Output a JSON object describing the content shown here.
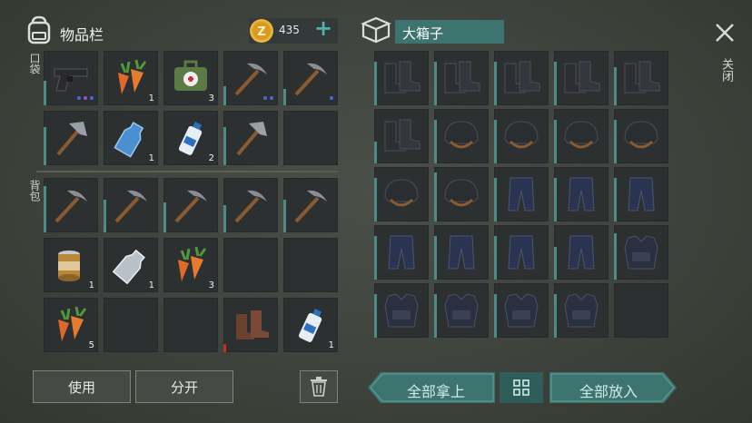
{
  "inventory": {
    "title": "物品栏",
    "coins": "435",
    "add_label": "+",
    "pocket_label": "口袋",
    "backpack_label": "背包",
    "use_button": "使用",
    "split_button": "分开",
    "slots": [
      {
        "icon": "pistol-icon",
        "qty": "",
        "dur": 0.45,
        "dots": [
          "#4a6bd0",
          "#8a5ad0",
          "#4a6bd0"
        ]
      },
      {
        "icon": "carrot-icon",
        "qty": "1",
        "dur": 0
      },
      {
        "icon": "medkit-icon",
        "qty": "3",
        "dur": 0
      },
      {
        "icon": "pickaxe-icon",
        "qty": "",
        "dur": 0.35,
        "dots": [
          "#4a6bd0",
          "#4a6bd0"
        ]
      },
      {
        "icon": "pickaxe-icon",
        "qty": "",
        "dur": 0.3,
        "dots": [
          "#4a6bd0"
        ]
      },
      {
        "icon": "hatchet-icon",
        "qty": "",
        "dur": 0.7
      },
      {
        "icon": "water-bottle-icon",
        "qty": "1",
        "dur": 0
      },
      {
        "icon": "spray-can-icon",
        "qty": "2",
        "dur": 0
      },
      {
        "icon": "hatchet-icon",
        "qty": "",
        "dur": 0.7
      },
      {
        "icon": "",
        "qty": "",
        "dur": 0
      },
      {
        "icon": "pickaxe-icon",
        "qty": "",
        "dur": 0.85
      },
      {
        "icon": "pickaxe-icon",
        "qty": "",
        "dur": 0.6
      },
      {
        "icon": "pickaxe-icon",
        "qty": "",
        "dur": 0.55
      },
      {
        "icon": "pickaxe-icon",
        "qty": "",
        "dur": 0.5
      },
      {
        "icon": "pickaxe-icon",
        "qty": "",
        "dur": 0.6
      },
      {
        "icon": "canned-food-icon",
        "qty": "1",
        "dur": 0
      },
      {
        "icon": "empty-bottle-icon",
        "qty": "1",
        "dur": 0
      },
      {
        "icon": "carrot-icon",
        "qty": "3",
        "dur": 0
      },
      {
        "icon": "",
        "qty": "",
        "dur": 0
      },
      {
        "icon": "",
        "qty": "",
        "dur": 0
      },
      {
        "icon": "carrot-icon",
        "qty": "5",
        "dur": 0
      },
      {
        "icon": "",
        "qty": "",
        "dur": 0
      },
      {
        "icon": "",
        "qty": "",
        "dur": 0
      },
      {
        "icon": "boots-brown-icon",
        "qty": "",
        "dur": 0.15,
        "durColor": "#c0302a"
      },
      {
        "icon": "spray-can-icon",
        "qty": "1",
        "dur": 0
      }
    ]
  },
  "box": {
    "title": "大箱子",
    "close_label": "关闭",
    "take_all_button": "全部拿上",
    "put_all_button": "全部放入",
    "slots": [
      {
        "icon": "boots-icon",
        "dur": 0.8
      },
      {
        "icon": "boots-icon",
        "dur": 0.8
      },
      {
        "icon": "boots-icon",
        "dur": 0.8
      },
      {
        "icon": "boots-icon",
        "dur": 0.8
      },
      {
        "icon": "boots-icon",
        "dur": 0.7
      },
      {
        "icon": "boots-icon",
        "dur": 0.4
      },
      {
        "icon": "helmet-icon",
        "dur": 0.8
      },
      {
        "icon": "helmet-icon",
        "dur": 0.8
      },
      {
        "icon": "helmet-icon",
        "dur": 0.8
      },
      {
        "icon": "helmet-icon",
        "dur": 0.8
      },
      {
        "icon": "helmet-icon",
        "dur": 0.8
      },
      {
        "icon": "helmet-icon",
        "dur": 0.9
      },
      {
        "icon": "pants-icon",
        "dur": 0.8
      },
      {
        "icon": "pants-icon",
        "dur": 0.8
      },
      {
        "icon": "pants-icon",
        "dur": 0.8
      },
      {
        "icon": "pants-icon",
        "dur": 0.8
      },
      {
        "icon": "pants-icon",
        "dur": 0.8
      },
      {
        "icon": "pants-icon",
        "dur": 0.8
      },
      {
        "icon": "pants-icon",
        "dur": 0.6
      },
      {
        "icon": "armor-vest-icon",
        "dur": 0.85
      },
      {
        "icon": "armor-vest-icon",
        "dur": 0.8
      },
      {
        "icon": "armor-vest-icon",
        "dur": 0.8
      },
      {
        "icon": "armor-vest-icon",
        "dur": 0.8
      },
      {
        "icon": "armor-vest-icon",
        "dur": 0.8
      },
      {
        "icon": "",
        "dur": 0
      }
    ]
  },
  "colors": {
    "accent": "#3d7470",
    "durability": "#4f8a86",
    "coin": "#e8b43a"
  }
}
